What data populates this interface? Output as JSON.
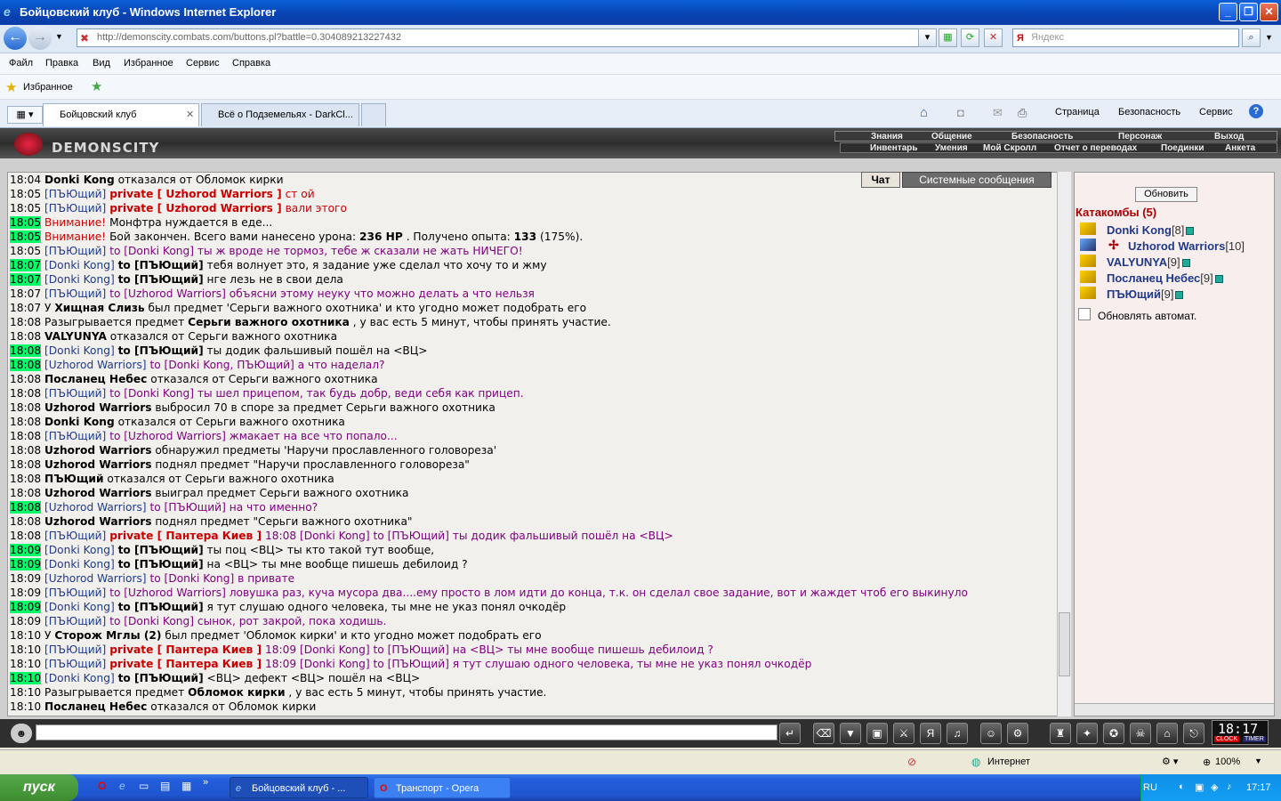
{
  "window": {
    "title": "Бойцовский клуб - Windows Internet Explorer"
  },
  "address": {
    "url": "http://demonscity.combats.com/buttons.pl?battle=0.304089213227432",
    "search_placeholder": "Яндекс"
  },
  "menu": [
    "Файл",
    "Правка",
    "Вид",
    "Избранное",
    "Сервис",
    "Справка"
  ],
  "favorites": {
    "label": "Избранное"
  },
  "tabs": [
    {
      "label": "Бойцовский клуб"
    },
    {
      "label": "Всё о Подземельях - DarkCl..."
    }
  ],
  "commands": {
    "page": "Страница",
    "safety": "Безопасность",
    "service": "Сервис"
  },
  "game": {
    "logo": "DEMONSCITY",
    "top_menu": [
      "Знания",
      "Общение",
      "Безопасность",
      "Персонаж",
      "Выход"
    ],
    "sub_menu": [
      "Инвентарь",
      "Умения",
      "Мой Скролл",
      "Отчет о переводах",
      "Поединки",
      "Анкета"
    ],
    "chat_tabs": {
      "chat": "Чат",
      "system": "Системные сообщения"
    },
    "refresh_button": "Обновить",
    "location": "Катакомбы (5)",
    "players": [
      {
        "name": "Donki Kong",
        "level": "[8]"
      },
      {
        "name": "Uzhorod Warriors",
        "level": "[10]"
      },
      {
        "name": "VALYUNYA",
        "level": "[9]"
      },
      {
        "name": "Посланец Небес",
        "level": "[9]"
      },
      {
        "name": "ПЪЮщий",
        "level": "[9]"
      }
    ],
    "auto_refresh_label": "Обновлять автомат.",
    "clock": "18:17",
    "clock_label": "CLOCK",
    "timer_label": "TIMER"
  },
  "chat": [
    {
      "t": "18:04",
      "h": false,
      "parts": [
        [
          "nm",
          "Donki Kong"
        ],
        [
          "",
          "отказался от Обломок кирки"
        ]
      ]
    },
    {
      "t": "18:05",
      "h": false,
      "parts": [
        [
          "cb",
          "[ПЪЮщий]"
        ],
        [
          "pv",
          "private [ Uzhorod Warriors ]"
        ],
        [
          "red",
          "ст ой"
        ]
      ]
    },
    {
      "t": "18:05",
      "h": false,
      "parts": [
        [
          "cb",
          "[ПЪЮщий]"
        ],
        [
          "pv",
          "private [ Uzhorod Warriors ]"
        ],
        [
          "red",
          "вали этого"
        ]
      ]
    },
    {
      "t": "18:05",
      "h": true,
      "parts": [
        [
          "red",
          "Внимание!"
        ],
        [
          "",
          "Монфтра нуждается в еде..."
        ]
      ]
    },
    {
      "t": "18:05",
      "h": true,
      "parts": [
        [
          "red",
          "Внимание!"
        ],
        [
          "",
          "Бой закончен. Всего вами нанесено урона:"
        ],
        [
          "nm",
          "236 HP"
        ],
        [
          "",
          ". Получено опыта:"
        ],
        [
          "nm",
          "133"
        ],
        [
          "",
          "(175%)."
        ]
      ]
    },
    {
      "t": "18:05",
      "h": false,
      "parts": [
        [
          "cb",
          "[ПЪЮщий]"
        ],
        [
          "vi",
          "to [Donki Kong] ты ж вроде не тормоз, тебе ж сказали не жать НИЧЕГО!"
        ]
      ]
    },
    {
      "t": "18:07",
      "h": true,
      "parts": [
        [
          "cb",
          "[Donki Kong]"
        ],
        [
          "nm",
          "to [ПЪЮщий]"
        ],
        [
          "",
          "тебя волнует это, я задание уже сделал что хочу то и жму"
        ]
      ]
    },
    {
      "t": "18:07",
      "h": true,
      "parts": [
        [
          "cb",
          "[Donki Kong]"
        ],
        [
          "nm",
          "to [ПЪЮщий]"
        ],
        [
          "",
          "нге лезь не в свои дела"
        ]
      ]
    },
    {
      "t": "18:07",
      "h": false,
      "parts": [
        [
          "cb",
          "[ПЪЮщий]"
        ],
        [
          "vi",
          "to [Uzhorod Warriors] объясни этому неуку что можно делать а что нельзя"
        ]
      ]
    },
    {
      "t": "18:07",
      "h": false,
      "parts": [
        [
          "",
          "У"
        ],
        [
          "nm",
          "Хищная Слизь"
        ],
        [
          "",
          "был предмет 'Серьги важного охотника' и кто угодно может подобрать его"
        ]
      ]
    },
    {
      "t": "18:08",
      "h": false,
      "parts": [
        [
          "",
          "Разыгрывается предмет"
        ],
        [
          "nm",
          "Серьги важного охотника"
        ],
        [
          "",
          ", у вас есть 5 минут, чтобы принять участие."
        ]
      ]
    },
    {
      "t": "18:08",
      "h": false,
      "parts": [
        [
          "nm",
          "VALYUNYA"
        ],
        [
          "",
          "отказался от Серьги важного охотника"
        ]
      ]
    },
    {
      "t": "18:08",
      "h": true,
      "parts": [
        [
          "cb",
          "[Donki Kong]"
        ],
        [
          "nm",
          "to [ПЪЮщий]"
        ],
        [
          "",
          "ты додик фальшивый пошёл на <ВЦ>"
        ]
      ]
    },
    {
      "t": "18:08",
      "h": true,
      "parts": [
        [
          "cb",
          "[Uzhorod Warriors]"
        ],
        [
          "vi",
          "to [Donki Kong, ПЪЮщий] а что наделал?"
        ]
      ]
    },
    {
      "t": "18:08",
      "h": false,
      "parts": [
        [
          "nm",
          "Посланец Небес"
        ],
        [
          "",
          "отказался от Серьги важного охотника"
        ]
      ]
    },
    {
      "t": "18:08",
      "h": false,
      "parts": [
        [
          "cb",
          "[ПЪЮщий]"
        ],
        [
          "vi",
          "to [Donki Kong] ты шел прицепом, так будь добр, веди себя как прицеп."
        ]
      ]
    },
    {
      "t": "18:08",
      "h": false,
      "parts": [
        [
          "nm",
          "Uzhorod Warriors"
        ],
        [
          "",
          "выбросил 70 в споре за предмет Серьги важного охотника"
        ]
      ]
    },
    {
      "t": "18:08",
      "h": false,
      "parts": [
        [
          "nm",
          "Donki Kong"
        ],
        [
          "",
          "отказался от Серьги важного охотника"
        ]
      ]
    },
    {
      "t": "18:08",
      "h": false,
      "parts": [
        [
          "cb",
          "[ПЪЮщий]"
        ],
        [
          "vi",
          "to [Uzhorod Warriors] жмакает на все что попало..."
        ]
      ]
    },
    {
      "t": "18:08",
      "h": false,
      "parts": [
        [
          "nm",
          "Uzhorod Warriors"
        ],
        [
          "",
          "обнаружил предметы 'Наручи прославленного головореза'"
        ]
      ]
    },
    {
      "t": "18:08",
      "h": false,
      "parts": [
        [
          "nm",
          "Uzhorod Warriors"
        ],
        [
          "",
          "поднял предмет \"Наручи прославленного головореза\""
        ]
      ]
    },
    {
      "t": "18:08",
      "h": false,
      "parts": [
        [
          "nm",
          "ПЪЮщий"
        ],
        [
          "",
          "отказался от Серьги важного охотника"
        ]
      ]
    },
    {
      "t": "18:08",
      "h": false,
      "parts": [
        [
          "nm",
          "Uzhorod Warriors"
        ],
        [
          "",
          "выиграл предмет Серьги важного охотника"
        ]
      ]
    },
    {
      "t": "18:08",
      "h": true,
      "parts": [
        [
          "cb",
          "[Uzhorod Warriors]"
        ],
        [
          "vi",
          "to [ПЪЮщий] на что именно?"
        ]
      ]
    },
    {
      "t": "18:08",
      "h": false,
      "parts": [
        [
          "nm",
          "Uzhorod Warriors"
        ],
        [
          "",
          "поднял предмет \"Серьги важного охотника\""
        ]
      ]
    },
    {
      "t": "18:08",
      "h": false,
      "parts": [
        [
          "cb",
          "[ПЪЮщий]"
        ],
        [
          "pv",
          "private [ Пантера Киев ]"
        ],
        [
          "vi",
          "18:08 [Donki Kong] to [ПЪЮщий] ты додик фальшивый пошёл на <ВЦ>"
        ]
      ]
    },
    {
      "t": "18:09",
      "h": true,
      "parts": [
        [
          "cb",
          "[Donki Kong]"
        ],
        [
          "nm",
          "to [ПЪЮщий]"
        ],
        [
          "",
          "ты поц <ВЦ> ты кто такой тут вообще,"
        ]
      ]
    },
    {
      "t": "18:09",
      "h": true,
      "parts": [
        [
          "cb",
          "[Donki Kong]"
        ],
        [
          "nm",
          "to [ПЪЮщий]"
        ],
        [
          "",
          "на <ВЦ> ты мне вообще пишешь дебилоид ?"
        ]
      ]
    },
    {
      "t": "18:09",
      "h": false,
      "parts": [
        [
          "cb",
          "[Uzhorod Warriors]"
        ],
        [
          "vi",
          "to [Donki Kong] в привате"
        ]
      ]
    },
    {
      "t": "18:09",
      "h": false,
      "parts": [
        [
          "cb",
          "[ПЪЮщий]"
        ],
        [
          "vi",
          "to [Uzhorod Warriors] ловушка раз, куча мусора два....ему просто в лом идти до конца, т.к. он сделал свое задание, вот и жаждет чтоб его выкинуло"
        ]
      ]
    },
    {
      "t": "18:09",
      "h": true,
      "parts": [
        [
          "cb",
          "[Donki Kong]"
        ],
        [
          "nm",
          "to [ПЪЮщий]"
        ],
        [
          "",
          "я тут слушаю одного человека, ты мне не указ понял очкодёр"
        ]
      ]
    },
    {
      "t": "18:09",
      "h": false,
      "parts": [
        [
          "cb",
          "[ПЪЮщий]"
        ],
        [
          "vi",
          "to [Donki Kong] сынок, рот закрой, пока ходишь."
        ]
      ]
    },
    {
      "t": "18:10",
      "h": false,
      "parts": [
        [
          "",
          "У"
        ],
        [
          "nm",
          "Сторож Мглы (2)"
        ],
        [
          "",
          "был предмет 'Обломок кирки' и кто угодно может подобрать его"
        ]
      ]
    },
    {
      "t": "18:10",
      "h": false,
      "parts": [
        [
          "cb",
          "[ПЪЮщий]"
        ],
        [
          "pv",
          "private [ Пантера Киев ]"
        ],
        [
          "vi",
          "18:09 [Donki Kong] to [ПЪЮщий] на <ВЦ> ты мне вообще пишешь дебилоид ?"
        ]
      ]
    },
    {
      "t": "18:10",
      "h": false,
      "parts": [
        [
          "cb",
          "[ПЪЮщий]"
        ],
        [
          "pv",
          "private [ Пантера Киев ]"
        ],
        [
          "vi",
          "18:09 [Donki Kong] to [ПЪЮщий] я тут слушаю одного человека, ты мне не указ понял очкодёр"
        ]
      ]
    },
    {
      "t": "18:10",
      "h": true,
      "parts": [
        [
          "cb",
          "[Donki Kong]"
        ],
        [
          "nm",
          "to [ПЪЮщий]"
        ],
        [
          "",
          "<ВЦ> дефект <ВЦ> пошёл на <ВЦ>"
        ]
      ]
    },
    {
      "t": "18:10",
      "h": false,
      "parts": [
        [
          "",
          "Разыгрывается предмет"
        ],
        [
          "nm",
          "Обломок кирки"
        ],
        [
          "",
          ", у вас есть 5 минут, чтобы принять участие."
        ]
      ]
    },
    {
      "t": "18:10",
      "h": false,
      "parts": [
        [
          "nm",
          "Посланец Небес"
        ],
        [
          "",
          "отказался от Обломок кирки"
        ]
      ]
    }
  ],
  "status": {
    "zone": "Интернет",
    "zoom": "100%"
  },
  "taskbar": {
    "start": "пуск",
    "tasks": [
      "Бойцовский клуб - ...",
      "Транспорт - Opera"
    ],
    "lang": "RU",
    "time": "17:17"
  }
}
